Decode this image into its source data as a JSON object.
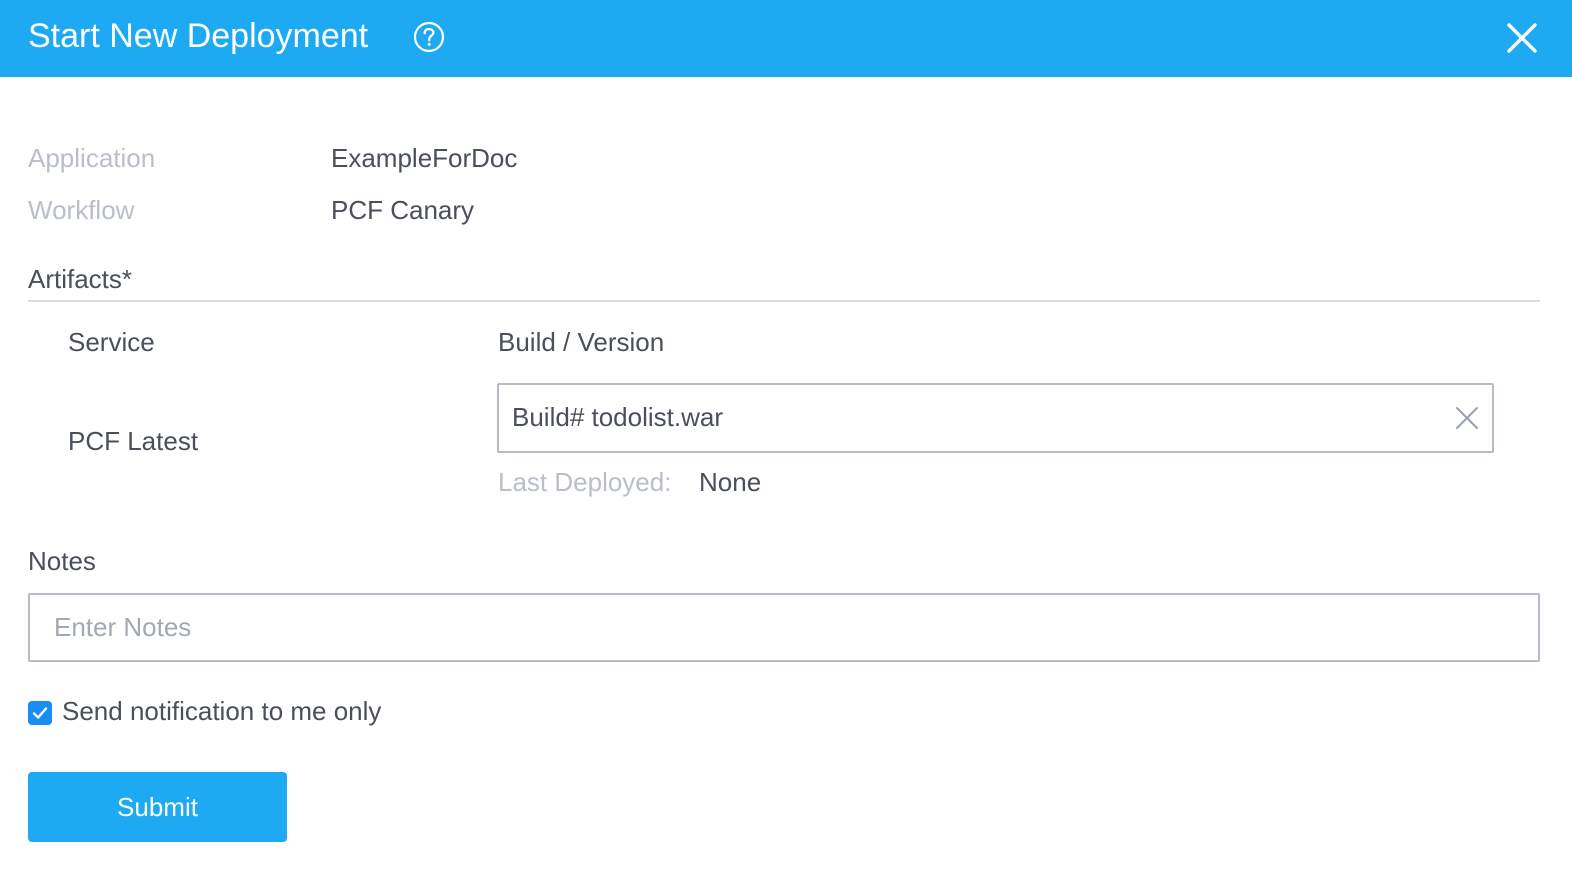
{
  "header": {
    "title": "Start New Deployment",
    "help_icon": "question-circle-icon",
    "close_icon": "close-icon"
  },
  "meta": {
    "application_label": "Application",
    "application_value": "ExampleForDoc",
    "workflow_label": "Workflow",
    "workflow_value": "PCF Canary"
  },
  "artifacts": {
    "title": "Artifacts*",
    "columns": {
      "service": "Service",
      "build_version": "Build / Version"
    },
    "rows": [
      {
        "service": "PCF Latest",
        "build": "Build# todolist.war",
        "last_deployed_label": "Last Deployed:",
        "last_deployed_value": "None"
      }
    ]
  },
  "notes": {
    "label": "Notes",
    "placeholder": "Enter Notes",
    "value": ""
  },
  "notification": {
    "label": "Send notification to me only",
    "checked": true
  },
  "submit_label": "Submit",
  "colors": {
    "header_bg": "#1daaf3",
    "checkbox": "#1a8df2",
    "text": "#4a4f5a",
    "muted": "#b9bec8"
  }
}
